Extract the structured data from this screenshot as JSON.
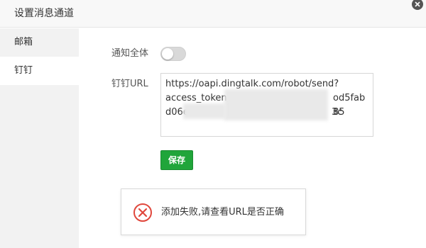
{
  "dialog": {
    "title": "设置消息通道"
  },
  "sidebar": {
    "items": [
      {
        "label": "邮箱"
      },
      {
        "label": "钉钉"
      }
    ]
  },
  "form": {
    "notify_all_label": "通知全体",
    "notify_all_enabled": false,
    "url_label": "钉钉URL",
    "url_line1": "https://oapi.dingtalk.com/robot/send?",
    "url_line2_prefix": "access_token=",
    "url_line2_suffix": "od5fab85",
    "url_line3_prefix": "d06e",
    "url_line3_suffix": "3c",
    "save_label": "保存"
  },
  "toast": {
    "message": "添加失败,请查看URL是否正确",
    "icon": "error-circle-icon"
  },
  "colors": {
    "accent": "#20a53a",
    "error": "#e0473c"
  }
}
